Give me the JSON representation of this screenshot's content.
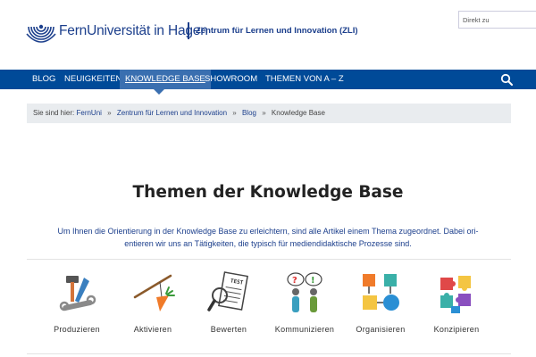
{
  "header": {
    "brand": "FernUniversität in Hagen",
    "sub_brand": "Zentrum für Lernen und Innovation (ZLI)",
    "search_placeholder": "Direkt zu"
  },
  "nav": {
    "items": [
      {
        "label": "Blog"
      },
      {
        "label": "Neuigkeiten"
      },
      {
        "label": "Knowledge Base",
        "active": true
      },
      {
        "label": "Showroom"
      },
      {
        "label": "Themen von A – Z"
      }
    ],
    "search_icon": "search-icon"
  },
  "breadcrumb": {
    "prefix": "Sie sind hier:",
    "items": [
      "FernUni",
      "Zentrum für Lernen und Innovation",
      "Blog",
      "Knowledge Base"
    ],
    "separator": "»"
  },
  "main": {
    "title": "Themen der Knowledge Base",
    "intro_line1": "Um Ihnen die Orientierung in der Knowledge Base zu erleichtern, sind alle Artikel einem Thema zugeordnet. Dabei ori-",
    "intro_line2": "entieren wir uns an Tätigkeiten, die typisch für mediendidaktische Prozesse sind.",
    "topics": [
      {
        "label": "Produzieren",
        "icon": "tools-icon"
      },
      {
        "label": "Aktivieren",
        "icon": "carrot-stick-icon"
      },
      {
        "label": "Bewerten",
        "icon": "test-paper-icon"
      },
      {
        "label": "Kommunizieren",
        "icon": "speech-people-icon"
      },
      {
        "label": "Organisieren",
        "icon": "flowchart-icon"
      },
      {
        "label": "Konzipieren",
        "icon": "puzzle-icon"
      }
    ]
  },
  "colors": {
    "brand_blue": "#004a98",
    "nav_active": "#3a6fb0",
    "link_blue": "#1c3f8c",
    "breadcrumb_bg": "#e9ecef"
  }
}
